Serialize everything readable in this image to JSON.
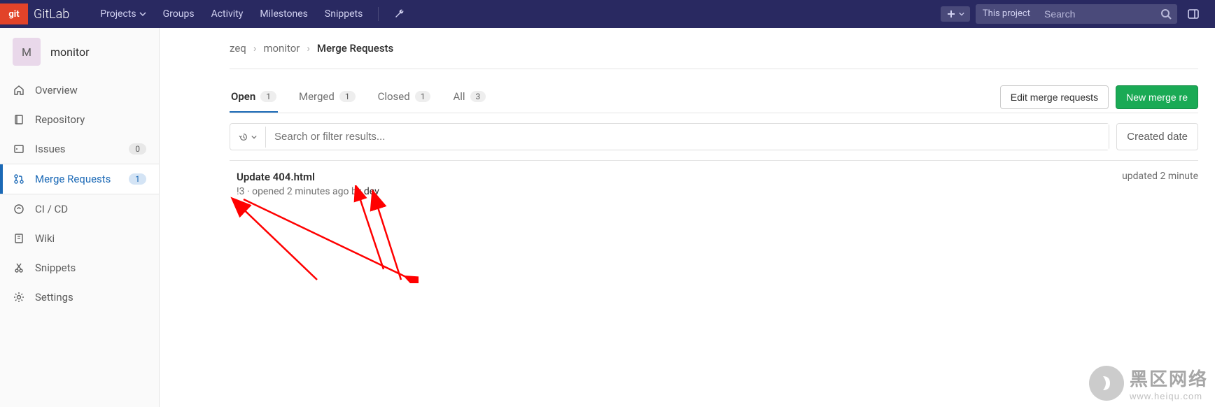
{
  "header": {
    "brand": "GitLab",
    "logo_text": "git",
    "nav": {
      "projects": "Projects",
      "groups": "Groups",
      "activity": "Activity",
      "milestones": "Milestones",
      "snippets": "Snippets"
    },
    "search_scope": "This project",
    "search_placeholder": "Search"
  },
  "sidebar": {
    "project_letter": "M",
    "project_name": "monitor",
    "items": {
      "overview": "Overview",
      "repository": "Repository",
      "issues": "Issues",
      "issues_count": "0",
      "merge_requests": "Merge Requests",
      "merge_requests_count": "1",
      "cicd": "CI / CD",
      "wiki": "Wiki",
      "snippets": "Snippets",
      "settings": "Settings"
    }
  },
  "breadcrumb": {
    "root": "zeq",
    "project": "monitor",
    "page": "Merge Requests"
  },
  "tabs": {
    "open": "Open",
    "open_count": "1",
    "merged": "Merged",
    "merged_count": "1",
    "closed": "Closed",
    "closed_count": "1",
    "all": "All",
    "all_count": "3"
  },
  "actions": {
    "edit": "Edit merge requests",
    "new": "New merge re"
  },
  "filter": {
    "placeholder": "Search or filter results...",
    "sort": "Created date"
  },
  "merge_requests": [
    {
      "title": "Update 404.html",
      "id": "!3",
      "meta_prefix": " · opened 2 minutes ago by ",
      "author": "dev",
      "updated": "updated 2 minute"
    }
  ],
  "watermark": {
    "title": "黑区网络",
    "url": "www.heiqu.com"
  }
}
